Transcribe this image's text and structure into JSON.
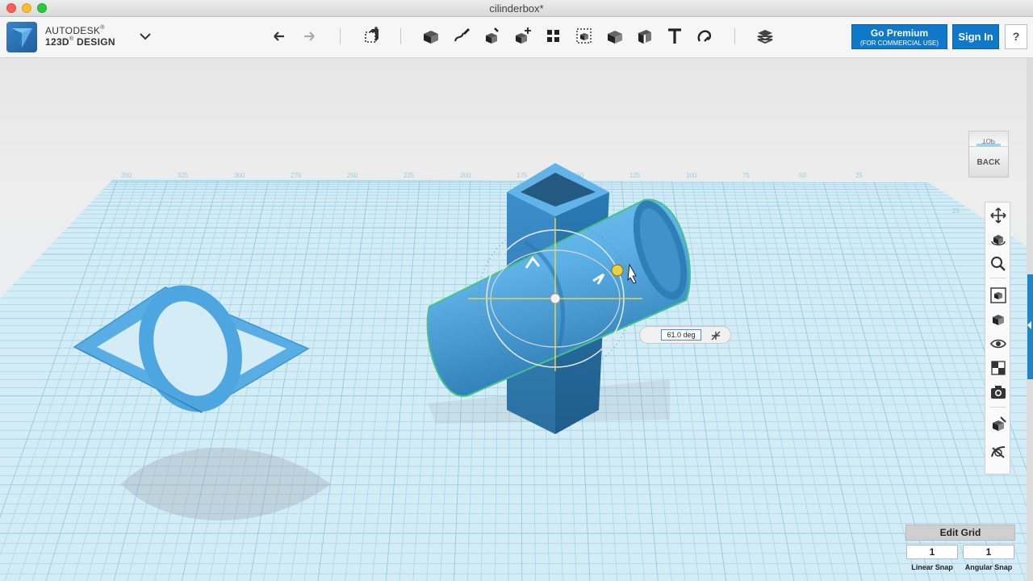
{
  "window": {
    "title": "cilinderbox*"
  },
  "brand": {
    "line1": "AUTODESK",
    "line1_mark": "®",
    "line2": "123D",
    "line2_mark": "®",
    "line2_rest": " DESIGN"
  },
  "toolbar": {
    "icons": [
      "undo-icon",
      "redo-icon",
      "transform-icon",
      "primitives-icon",
      "sketch-icon",
      "construct-icon",
      "modify-icon",
      "pattern-icon",
      "grouping-icon",
      "combine-icon",
      "measure-icon",
      "text-icon",
      "snap-icon",
      "material-icon"
    ]
  },
  "premium": {
    "label": "Go Premium",
    "sublabel": "(FOR COMMERCIAL USE)"
  },
  "signin": {
    "label": "Sign In"
  },
  "help": {
    "label": "?"
  },
  "viewcube": {
    "top_label": "TOP",
    "front_label": "BACK"
  },
  "navbar": {
    "icons": [
      "pan-icon",
      "orbit-icon",
      "zoom-icon",
      "fit-icon",
      "view-icon",
      "visibility-icon",
      "materials-icon",
      "camera-icon",
      "hide-icon",
      "outline-icon"
    ]
  },
  "angle": {
    "value": "61.0 deg"
  },
  "grid": {
    "edit_label": "Edit Grid",
    "linear_snap_value": "1",
    "angular_snap_value": "1",
    "linear_snap_label": "Linear Snap",
    "angular_snap_label": "Angular Snap",
    "ruler_labels": [
      "350",
      "325",
      "300",
      "275",
      "250",
      "225",
      "200",
      "175",
      "150",
      "125",
      "100",
      "75",
      "50",
      "25"
    ],
    "side_label": "25"
  },
  "colors": {
    "accent": "#0f78c8",
    "object_blue": "#4ea6e0",
    "object_dark": "#2f7fb7",
    "grid_line": "#9fd0e8",
    "grid_bg": "#d2ebf5",
    "selection_green": "#4cc08a"
  }
}
